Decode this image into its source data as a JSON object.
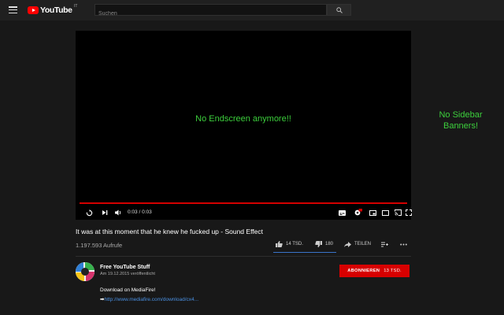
{
  "masthead": {
    "logo_text": "YouTube",
    "logo_country": "IT",
    "search_placeholder": "Suchen",
    "icons": {
      "menu": "hamburger-menu-icon",
      "search": "search-icon"
    }
  },
  "player": {
    "overlay_text": "No Endscreen anymore!!",
    "time_display": "0:03 / 0:03",
    "progress_fraction": 1.0,
    "progress_color": "#d40000",
    "icons": [
      "replay-icon",
      "next-icon",
      "volume-icon",
      "subtitles-icon",
      "settings-icon",
      "miniplayer-icon",
      "theater-mode-icon",
      "cast-icon",
      "fullscreen-icon"
    ]
  },
  "sidebar_note": {
    "line1": "No Sidebar",
    "line2": "Banners!"
  },
  "video": {
    "title": "It was at this moment that he knew he fucked up - Sound Effect",
    "views": "1.197.593 Aufrufe",
    "likes": "14 TSD.",
    "dislikes": "180",
    "share_label": "TEILEN",
    "icons": [
      "thumbs-up-icon",
      "thumbs-down-icon",
      "share-icon",
      "add-to-playlist-icon",
      "more-options-icon"
    ]
  },
  "channel": {
    "name": "Free YouTube Stuff",
    "published": "Am 19.12.2015 veröffentlicht",
    "subscribe_label": "ABONNIEREN",
    "subscriber_count": "13 TSD."
  },
  "description": {
    "line1": "Download on MediaFire!",
    "link_prefix": "➡",
    "link_text": "http://www.mediafire.com/download/cx4..."
  },
  "colors": {
    "background": "#181818",
    "masthead": "#202020",
    "accent_red": "#ff0000",
    "note_green": "#3ccf3c",
    "link_blue": "#4a90e2"
  }
}
